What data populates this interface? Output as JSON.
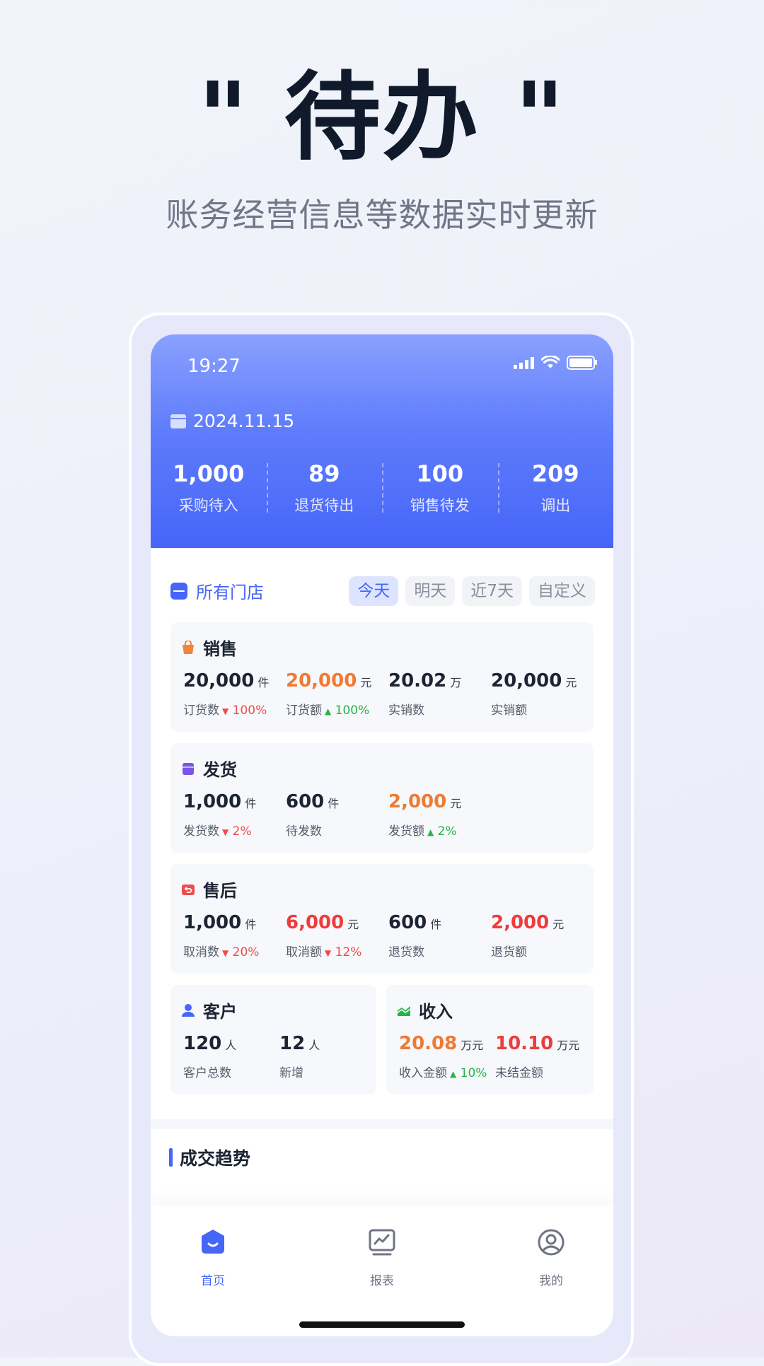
{
  "hero": {
    "title": "\" 待办 \"",
    "subtitle": "账务经营信息等数据实时更新"
  },
  "status_bar": {
    "time": "19:27"
  },
  "header": {
    "date": "2024.11.15",
    "stats": [
      {
        "value": "1,000",
        "label": "采购待入"
      },
      {
        "value": "89",
        "label": "退货待出"
      },
      {
        "value": "100",
        "label": "销售待发"
      },
      {
        "value": "209",
        "label": "调出"
      }
    ]
  },
  "filter": {
    "store": "所有门店",
    "tabs": [
      "今天",
      "明天",
      "近7天",
      "自定义"
    ],
    "active_tab": "今天"
  },
  "sales": {
    "title": "销售",
    "metrics": [
      {
        "value": "20,000",
        "unit": "件",
        "label": "订货数",
        "change": "100%",
        "dir": "down"
      },
      {
        "value": "20,000",
        "unit": "元",
        "label": "订货额",
        "change": "100%",
        "dir": "up"
      },
      {
        "value": "20.02",
        "unit": "万",
        "label": "实销数"
      },
      {
        "value": "20,000",
        "unit": "元",
        "label": "实销额"
      }
    ]
  },
  "shipping": {
    "title": "发货",
    "metrics": [
      {
        "value": "1,000",
        "unit": "件",
        "label": "发货数",
        "change": "2%",
        "dir": "down"
      },
      {
        "value": "600",
        "unit": "件",
        "label": "待发数"
      },
      {
        "value": "2,000",
        "unit": "元",
        "label": "发货额",
        "change": "2%",
        "dir": "up"
      }
    ]
  },
  "after_sales": {
    "title": "售后",
    "metrics": [
      {
        "value": "1,000",
        "unit": "件",
        "label": "取消数",
        "change": "20%",
        "dir": "down"
      },
      {
        "value": "6,000",
        "unit": "元",
        "label": "取消额",
        "change": "12%",
        "dir": "down"
      },
      {
        "value": "600",
        "unit": "件",
        "label": "退货数"
      },
      {
        "value": "2,000",
        "unit": "元",
        "label": "退货额"
      }
    ]
  },
  "customers": {
    "title": "客户",
    "metrics": [
      {
        "value": "120",
        "unit": "人",
        "label": "客户总数"
      },
      {
        "value": "12",
        "unit": "人",
        "label": "新增"
      }
    ]
  },
  "income": {
    "title": "收入",
    "metrics": [
      {
        "value": "20.08",
        "unit": "万元",
        "label": "收入金额",
        "change": "10%",
        "dir": "up"
      },
      {
        "value": "10.10",
        "unit": "万元",
        "label": "未结金额"
      }
    ]
  },
  "trend": {
    "title": "成交趋势"
  },
  "nav": [
    {
      "label": "首页",
      "icon": "home-icon"
    },
    {
      "label": "报表",
      "icon": "report-chart-icon"
    },
    {
      "label": "我的",
      "icon": "profile-icon"
    }
  ],
  "colors": {
    "accent": "#4566f8",
    "orange": "#f07a32",
    "red": "#ee3b3b",
    "green": "#27b34a"
  }
}
